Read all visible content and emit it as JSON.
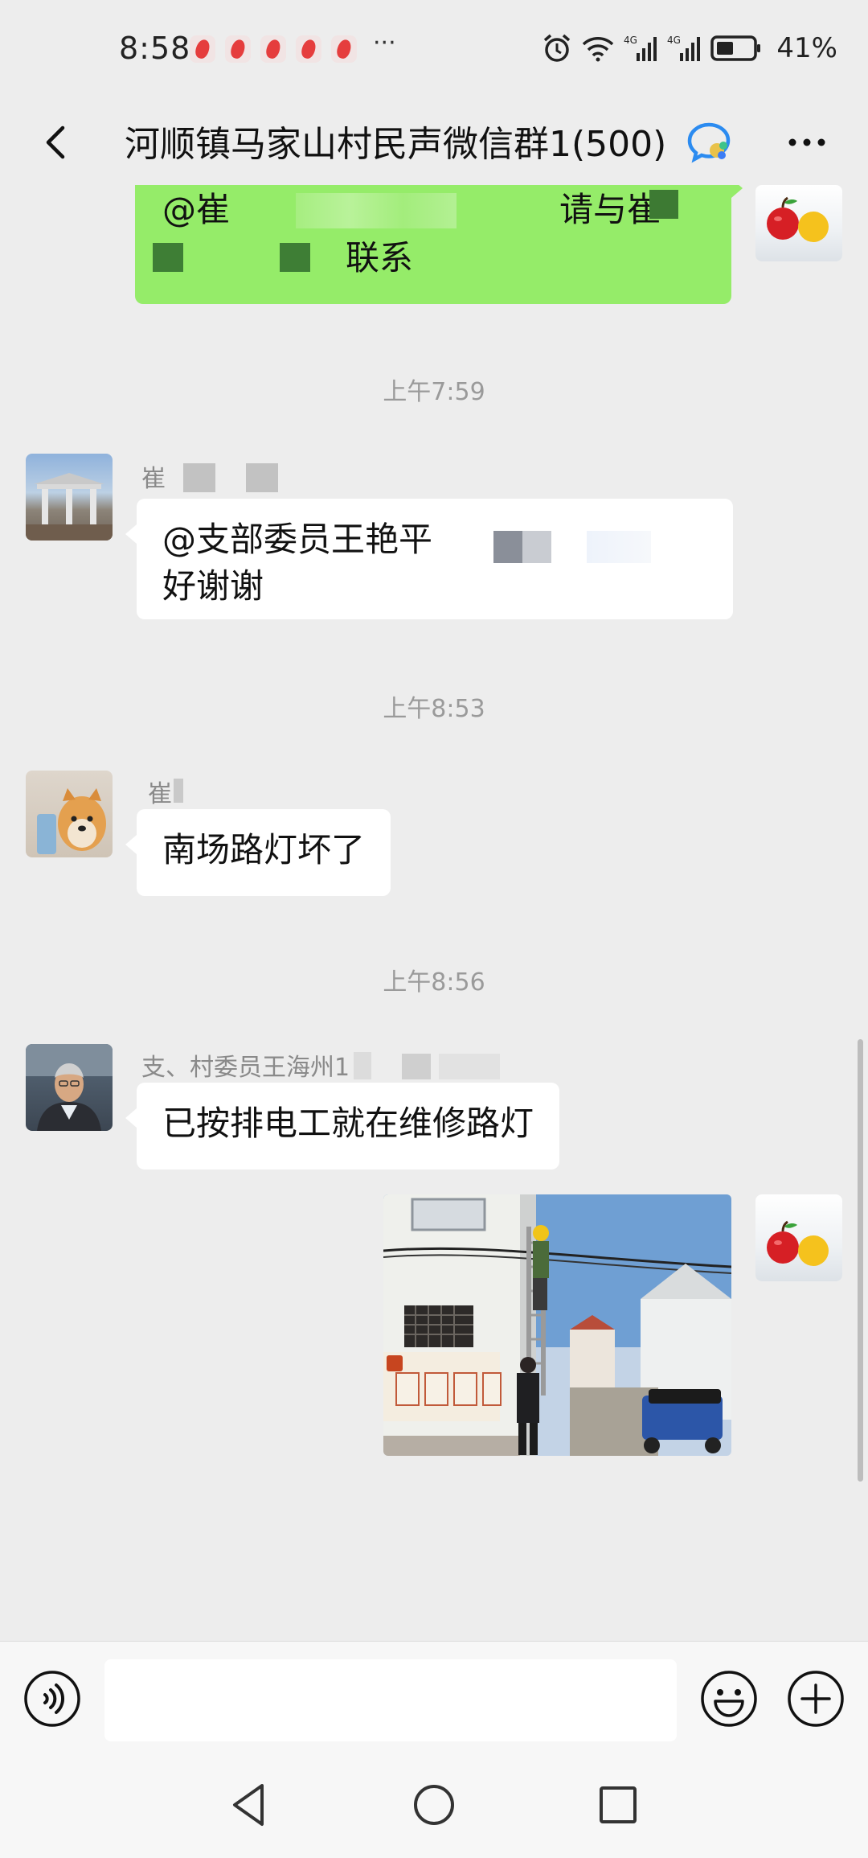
{
  "status_bar": {
    "time": "8:58",
    "more": "···",
    "battery": "41%",
    "network": "4G"
  },
  "header": {
    "title": "河顺镇马家山村民声微信群1(500)"
  },
  "messages": [
    {
      "direction": "out",
      "lines": [
        "@崔",
        "请与崔",
        "联系"
      ]
    },
    {
      "timestamp": "上午7:59"
    },
    {
      "direction": "in",
      "sender": "崔",
      "lines": [
        "@支部委员王艳平",
        "好谢谢"
      ]
    },
    {
      "timestamp": "上午8:53"
    },
    {
      "direction": "in",
      "sender": "崔",
      "text": "南场路灯坏了"
    },
    {
      "timestamp": "上午8:56"
    },
    {
      "direction": "in",
      "sender": "支、村委员王海州1",
      "text": "已按排电工就在维修路灯"
    },
    {
      "direction": "out",
      "type": "image"
    }
  ],
  "input": {
    "placeholder": ""
  },
  "colors": {
    "background": "#ededed",
    "bubble_out": "#95ec69",
    "bubble_in": "#ffffff",
    "timestamp": "#9a9a9a"
  }
}
